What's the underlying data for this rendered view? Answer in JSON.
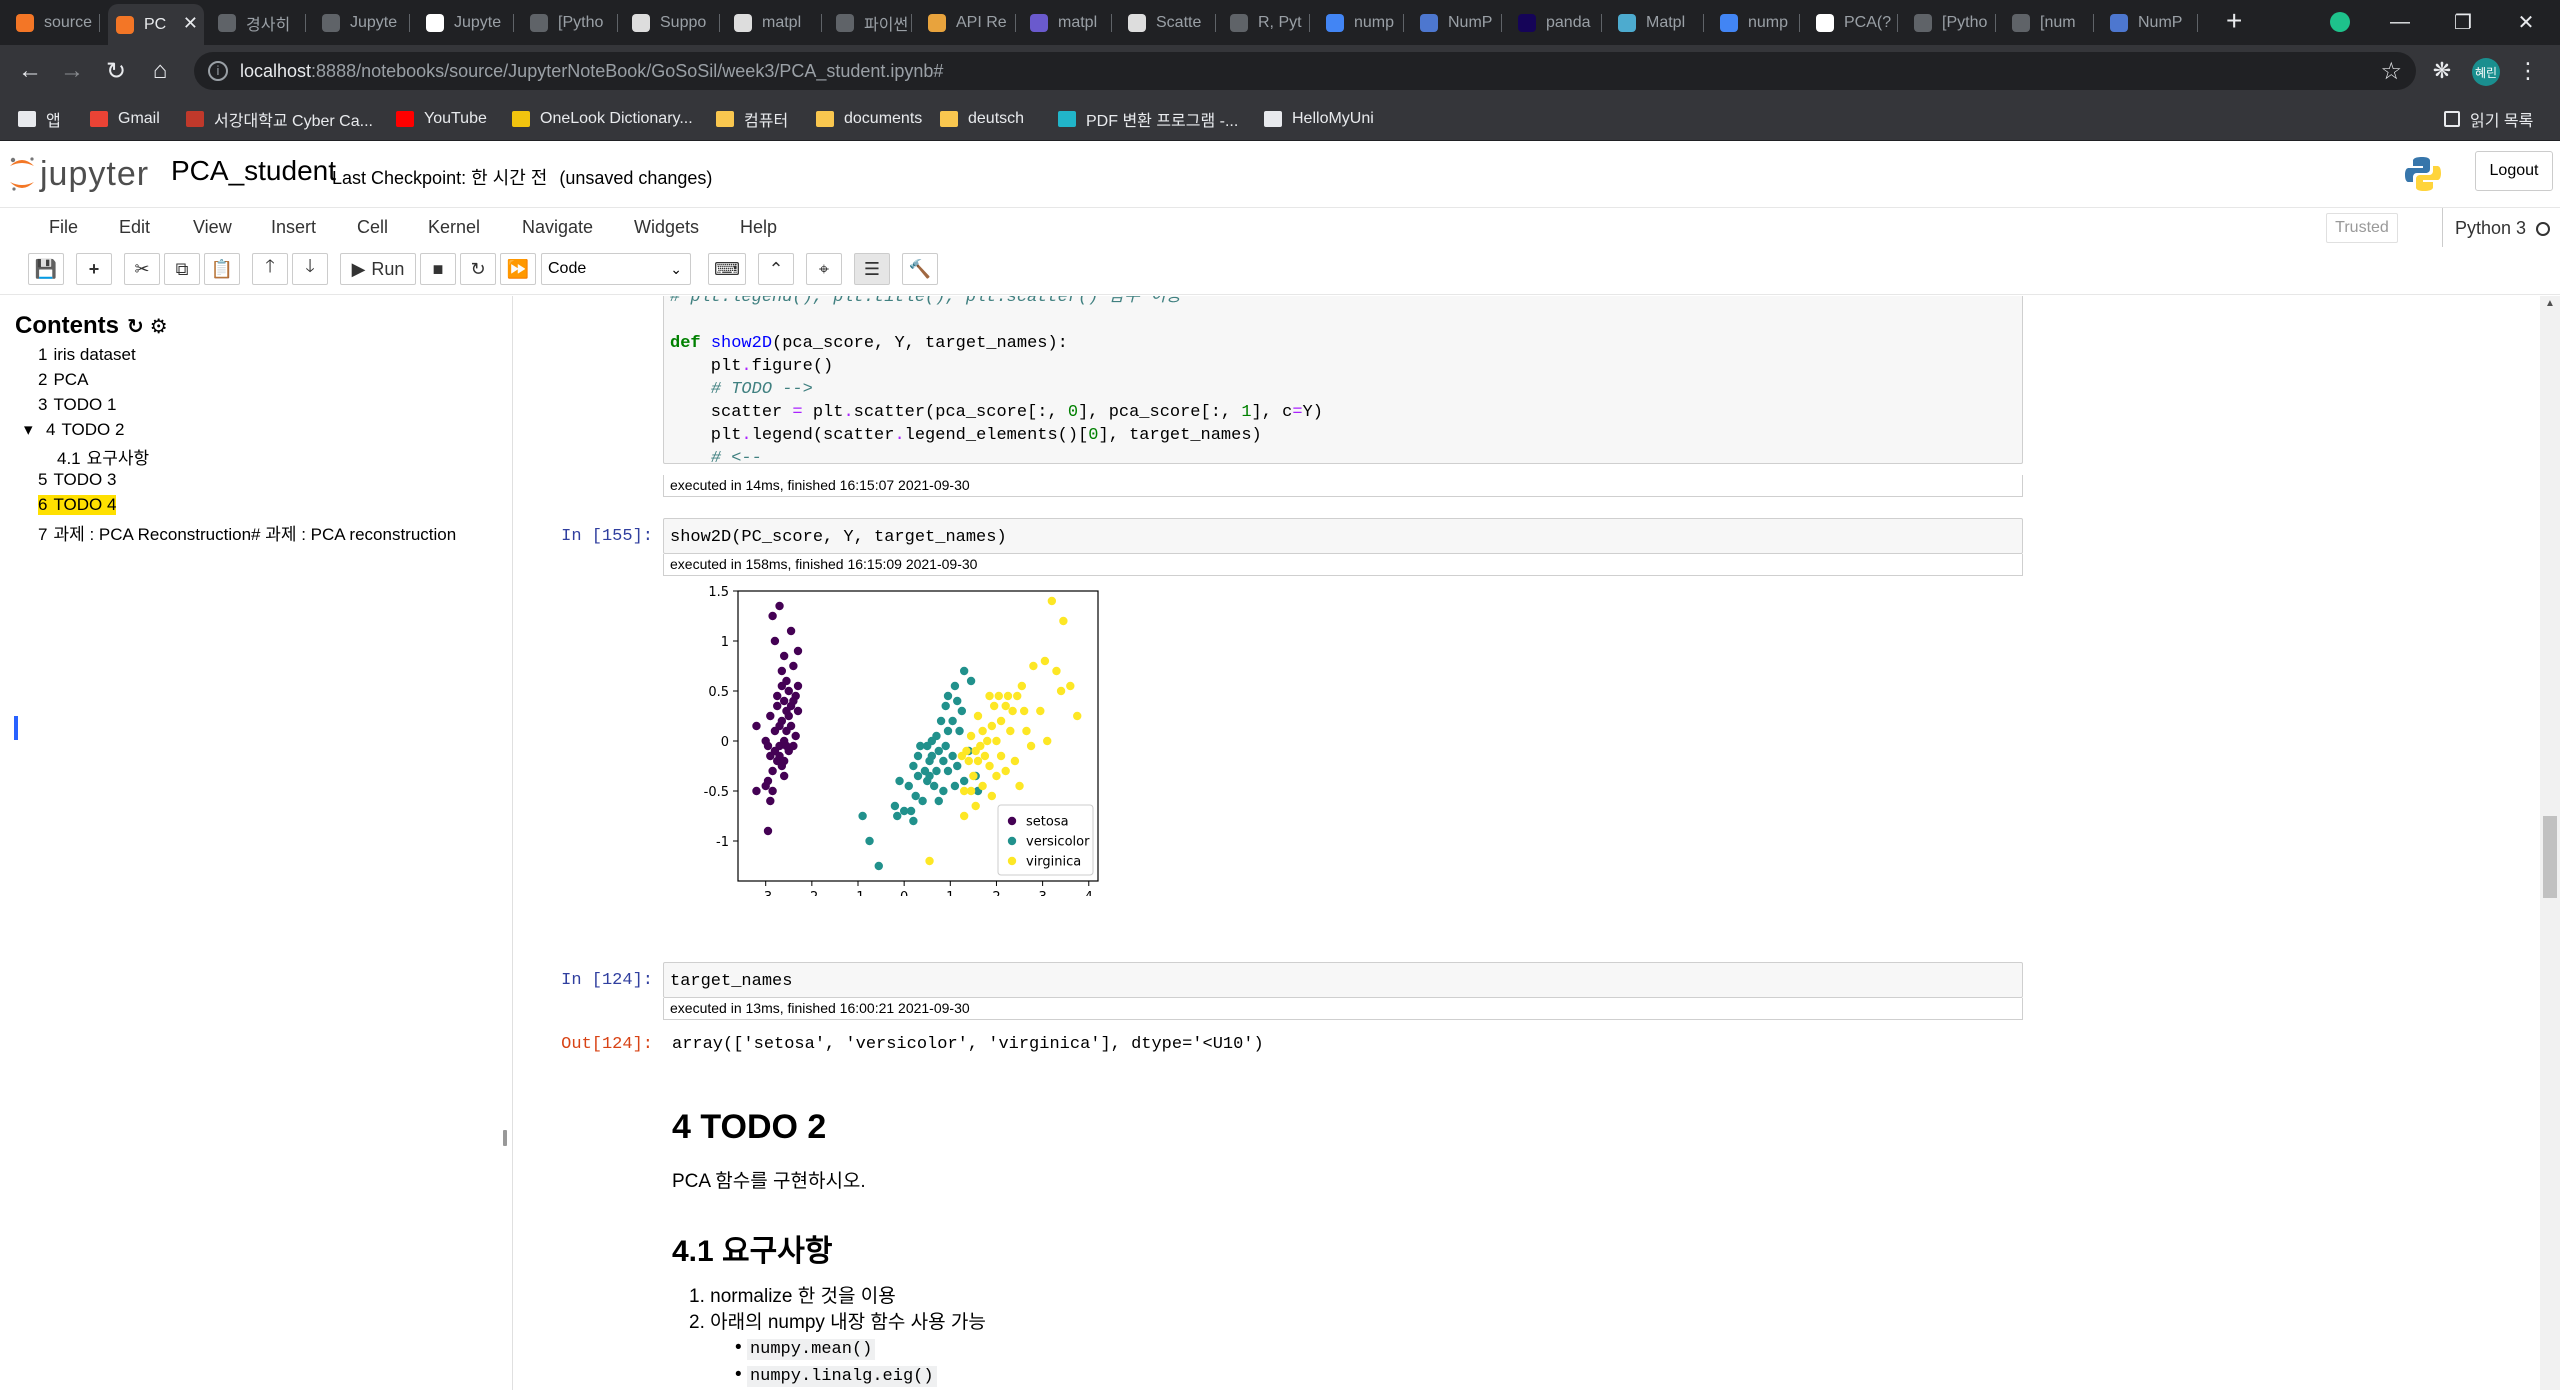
{
  "browser": {
    "tabs": [
      {
        "label": "source",
        "color": "#f37626"
      },
      {
        "label": "PC",
        "color": "#f37626",
        "active": true
      },
      {
        "label": "경사히",
        "color": "#5f6368"
      },
      {
        "label": "Jupyte",
        "color": "#5f6368"
      },
      {
        "label": "Jupyte",
        "color": "#ffffff"
      },
      {
        "label": "[Pytho",
        "color": "#5f6368"
      },
      {
        "label": "Suppo",
        "color": "#dddddd"
      },
      {
        "label": "matpl",
        "color": "#dddddd"
      },
      {
        "label": "파이썬",
        "color": "#5f6368"
      },
      {
        "label": "API Re",
        "color": "#e8a33d"
      },
      {
        "label": "matpl",
        "color": "#6a5acd"
      },
      {
        "label": "Scatte",
        "color": "#dddddd"
      },
      {
        "label": "R, Pyt",
        "color": "#5f6368"
      },
      {
        "label": "nump",
        "color": "#4285f4"
      },
      {
        "label": "NumP",
        "color": "#4d77cf"
      },
      {
        "label": "panda",
        "color": "#150458"
      },
      {
        "label": "Matpl",
        "color": "#4dabcf"
      },
      {
        "label": "nump",
        "color": "#4285f4"
      },
      {
        "label": "PCA(?",
        "color": "#ffffff"
      },
      {
        "label": "[Pytho",
        "color": "#5f6368"
      },
      {
        "label": "[num",
        "color": "#5f6368"
      },
      {
        "label": "NumP",
        "color": "#4d77cf"
      }
    ],
    "url_host": "localhost",
    "url_rest": ":8888/notebooks/source/JupyterNoteBook/GoSoSil/week3/PCA_student.ipynb#",
    "profile_initials": "혜린",
    "bookmarks": [
      {
        "label": "앱",
        "color": "#e8eaed"
      },
      {
        "label": "Gmail",
        "color": "#ea4335"
      },
      {
        "label": "서강대학교 Cyber Ca...",
        "color": "#c0392b"
      },
      {
        "label": "YouTube",
        "color": "#ff0000"
      },
      {
        "label": "OneLook Dictionary...",
        "color": "#f1c40f"
      },
      {
        "label": "컴퓨터",
        "color": "#f9c74f"
      },
      {
        "label": "documents",
        "color": "#f9c74f"
      },
      {
        "label": "deutsch",
        "color": "#f9c74f"
      },
      {
        "label": "PDF 변환 프로그램 -...",
        "color": "#21b5c9"
      },
      {
        "label": "HelloMyUni",
        "color": "#e8eaed"
      }
    ],
    "reading_list": "읽기 목록"
  },
  "jupyter": {
    "logo_text": "jupyter",
    "notebook_name": "PCA_student",
    "checkpoint": "Last Checkpoint: 한 시간 전",
    "unsaved": "(unsaved changes)",
    "logout": "Logout",
    "menus": [
      "File",
      "Edit",
      "View",
      "Insert",
      "Cell",
      "Kernel",
      "Navigate",
      "Widgets",
      "Help"
    ],
    "trusted": "Trusted",
    "kernel": "Python 3",
    "run_label": "Run",
    "cell_type": "Code"
  },
  "toc": {
    "title": "Contents",
    "items": [
      {
        "num": "1",
        "label": "iris dataset"
      },
      {
        "num": "2",
        "label": "PCA"
      },
      {
        "num": "3",
        "label": "TODO 1"
      },
      {
        "num": "4",
        "label": "TODO 2"
      },
      {
        "num": "4.1",
        "label": "요구사항"
      },
      {
        "num": "5",
        "label": "TODO 3"
      },
      {
        "num": "6",
        "label": "TODO 4"
      },
      {
        "num": "7",
        "label": "과제 : PCA Reconstruction# 과제 : PCA reconstruction"
      }
    ]
  },
  "cells": {
    "cell1": {
      "exec_info": "executed in 14ms, finished 16:15:07 2021-09-30"
    },
    "cell2": {
      "prompt": "In [155]:",
      "code": "show2D(PC_score, Y, target_names)",
      "exec_info": "executed in 158ms, finished 16:15:09 2021-09-30"
    },
    "cell3": {
      "prompt": "In [124]:",
      "code": "target_names",
      "exec_info": "executed in 13ms, finished 16:00:21 2021-09-30",
      "out_prompt": "Out[124]:",
      "output": "array(['setosa', 'versicolor', 'virginica'], dtype='<U10')"
    },
    "md": {
      "h1": "4  TODO 2",
      "p": "PCA 함수를 구현하시오.",
      "h2": "4.1  요구사항",
      "li1_code": "normalize",
      "li1_rest": " 한 것을 이용",
      "li2_pre": "아래의 ",
      "li2_code": "numpy",
      "li2_rest": " 내장 함수 사용 가능",
      "sub1": "numpy.mean()",
      "sub2": "numpy.linalg.eig()"
    }
  },
  "chart_data": {
    "type": "scatter",
    "xlim": [
      -3.6,
      4.2
    ],
    "ylim": [
      -1.4,
      1.5
    ],
    "xticks": [
      -3,
      -2,
      -1,
      0,
      1,
      2,
      3,
      4
    ],
    "yticks": [
      1.5,
      1.0,
      0.5,
      0.0,
      -0.5,
      -1.0
    ],
    "legend_position": "lower-right",
    "series": [
      {
        "name": "setosa",
        "color": "#440154",
        "points": [
          [
            -2.7,
            1.35
          ],
          [
            -2.85,
            1.25
          ],
          [
            -2.45,
            1.1
          ],
          [
            -2.3,
            0.9
          ],
          [
            -2.8,
            1.0
          ],
          [
            -2.6,
            0.85
          ],
          [
            -2.65,
            0.7
          ],
          [
            -2.4,
            0.75
          ],
          [
            -2.55,
            0.6
          ],
          [
            -2.3,
            0.55
          ],
          [
            -2.5,
            0.5
          ],
          [
            -2.35,
            0.45
          ],
          [
            -2.6,
            0.4
          ],
          [
            -2.75,
            0.45
          ],
          [
            -2.45,
            0.35
          ],
          [
            -2.55,
            0.3
          ],
          [
            -2.65,
            0.2
          ],
          [
            -2.45,
            0.15
          ],
          [
            -2.55,
            0.1
          ],
          [
            -2.9,
            0.25
          ],
          [
            -2.8,
            0.1
          ],
          [
            -2.6,
            0.0
          ],
          [
            -2.7,
            -0.05
          ],
          [
            -2.8,
            -0.1
          ],
          [
            -2.5,
            -0.1
          ],
          [
            -2.75,
            -0.2
          ],
          [
            -2.65,
            -0.25
          ],
          [
            -2.85,
            -0.3
          ],
          [
            -2.6,
            -0.35
          ],
          [
            -2.7,
            -0.15
          ],
          [
            -3.2,
            0.15
          ],
          [
            -3.0,
            0.0
          ],
          [
            -2.95,
            -0.4
          ],
          [
            -3.0,
            -0.45
          ],
          [
            -3.2,
            -0.5
          ],
          [
            -2.85,
            -0.5
          ],
          [
            -2.3,
            0.3
          ],
          [
            -2.4,
            -0.05
          ],
          [
            -2.5,
            0.25
          ],
          [
            -2.9,
            -0.15
          ],
          [
            -2.95,
            -0.05
          ],
          [
            -2.55,
            -0.05
          ],
          [
            -2.65,
            0.55
          ],
          [
            -2.4,
            0.4
          ],
          [
            -2.7,
            0.15
          ],
          [
            -2.9,
            -0.6
          ],
          [
            -2.95,
            -0.9
          ],
          [
            -2.35,
            0.05
          ],
          [
            -2.75,
            0.35
          ],
          [
            -2.6,
            -0.2
          ]
        ]
      },
      {
        "name": "versicolor",
        "color": "#21918c",
        "points": [
          [
            1.3,
            0.7
          ],
          [
            1.45,
            0.6
          ],
          [
            1.1,
            0.55
          ],
          [
            0.95,
            0.45
          ],
          [
            1.15,
            0.4
          ],
          [
            0.9,
            0.35
          ],
          [
            1.25,
            0.3
          ],
          [
            1.05,
            0.2
          ],
          [
            0.8,
            0.2
          ],
          [
            1.2,
            0.1
          ],
          [
            0.95,
            0.1
          ],
          [
            0.7,
            0.05
          ],
          [
            0.6,
            0.0
          ],
          [
            0.5,
            -0.05
          ],
          [
            0.75,
            -0.1
          ],
          [
            0.9,
            -0.05
          ],
          [
            1.05,
            -0.15
          ],
          [
            0.85,
            -0.2
          ],
          [
            0.55,
            -0.2
          ],
          [
            0.3,
            -0.15
          ],
          [
            0.2,
            -0.25
          ],
          [
            0.45,
            -0.3
          ],
          [
            0.7,
            -0.3
          ],
          [
            0.95,
            -0.3
          ],
          [
            1.15,
            -0.25
          ],
          [
            0.3,
            -0.35
          ],
          [
            0.5,
            -0.4
          ],
          [
            0.65,
            -0.45
          ],
          [
            0.85,
            -0.5
          ],
          [
            1.3,
            -0.4
          ],
          [
            1.55,
            -0.35
          ],
          [
            0.1,
            -0.45
          ],
          [
            -0.1,
            -0.4
          ],
          [
            0.25,
            -0.55
          ],
          [
            0.4,
            -0.6
          ],
          [
            0.15,
            -0.7
          ],
          [
            0.0,
            -0.7
          ],
          [
            -0.15,
            -0.75
          ],
          [
            -0.2,
            -0.65
          ],
          [
            0.2,
            -0.8
          ],
          [
            -0.9,
            -0.75
          ],
          [
            -0.75,
            -1.0
          ],
          [
            -0.55,
            -1.25
          ],
          [
            0.6,
            -0.15
          ],
          [
            1.1,
            -0.45
          ],
          [
            1.4,
            -0.1
          ],
          [
            0.35,
            -0.05
          ],
          [
            0.75,
            -0.6
          ],
          [
            1.6,
            -0.5
          ],
          [
            0.55,
            -0.35
          ]
        ]
      },
      {
        "name": "virginica",
        "color": "#fde725",
        "points": [
          [
            3.2,
            1.4
          ],
          [
            3.45,
            1.2
          ],
          [
            3.05,
            0.8
          ],
          [
            3.3,
            0.7
          ],
          [
            2.8,
            0.75
          ],
          [
            3.6,
            0.55
          ],
          [
            3.4,
            0.5
          ],
          [
            3.75,
            0.25
          ],
          [
            2.55,
            0.55
          ],
          [
            2.45,
            0.45
          ],
          [
            2.25,
            0.45
          ],
          [
            2.05,
            0.45
          ],
          [
            1.95,
            0.35
          ],
          [
            1.85,
            0.45
          ],
          [
            2.2,
            0.35
          ],
          [
            2.35,
            0.3
          ],
          [
            2.6,
            0.3
          ],
          [
            2.1,
            0.2
          ],
          [
            1.9,
            0.15
          ],
          [
            1.7,
            0.1
          ],
          [
            2.3,
            0.1
          ],
          [
            1.8,
            0.0
          ],
          [
            2.0,
            0.0
          ],
          [
            1.45,
            0.05
          ],
          [
            1.55,
            -0.1
          ],
          [
            1.65,
            -0.05
          ],
          [
            1.35,
            -0.1
          ],
          [
            1.4,
            -0.2
          ],
          [
            1.25,
            -0.15
          ],
          [
            1.6,
            -0.2
          ],
          [
            2.1,
            -0.15
          ],
          [
            2.4,
            -0.2
          ],
          [
            1.85,
            -0.25
          ],
          [
            2.2,
            -0.3
          ],
          [
            1.5,
            -0.35
          ],
          [
            1.7,
            -0.45
          ],
          [
            2.5,
            -0.45
          ],
          [
            1.3,
            -0.5
          ],
          [
            1.9,
            -0.55
          ],
          [
            1.55,
            -0.65
          ],
          [
            1.3,
            -0.75
          ],
          [
            0.55,
            -1.2
          ],
          [
            2.75,
            -0.05
          ],
          [
            3.1,
            0.0
          ],
          [
            2.95,
            0.3
          ],
          [
            2.65,
            0.1
          ],
          [
            1.45,
            -0.5
          ],
          [
            1.75,
            -0.15
          ],
          [
            2.0,
            -0.35
          ],
          [
            1.6,
            0.25
          ]
        ]
      }
    ]
  }
}
